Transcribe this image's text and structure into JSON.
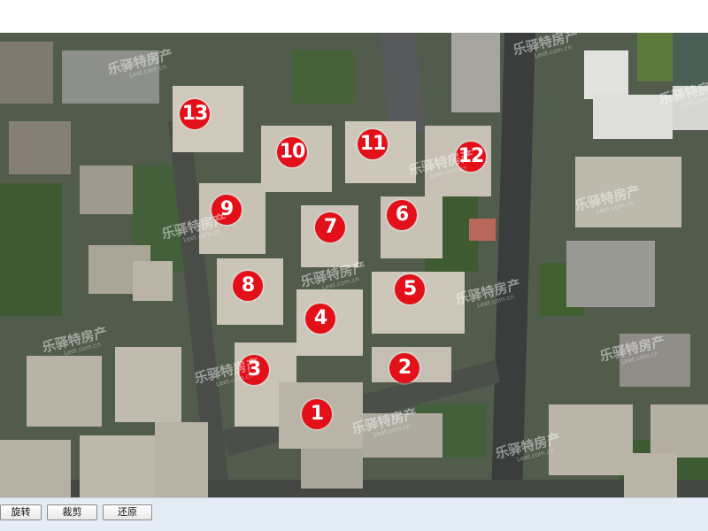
{
  "map": {
    "markers": [
      {
        "label": "1"
      },
      {
        "label": "2"
      },
      {
        "label": "3"
      },
      {
        "label": "4"
      },
      {
        "label": "5"
      },
      {
        "label": "6"
      },
      {
        "label": "7"
      },
      {
        "label": "8"
      },
      {
        "label": "9"
      },
      {
        "label": "10"
      },
      {
        "label": "11"
      },
      {
        "label": "12"
      },
      {
        "label": "13"
      }
    ],
    "watermark": {
      "brand": "乐驿特房产",
      "url": "Leet.com.cn"
    },
    "marker_color": "#e3101a"
  },
  "toolbar": {
    "rotate_label": "旋转",
    "crop_label": "裁剪",
    "restore_label": "还原"
  }
}
